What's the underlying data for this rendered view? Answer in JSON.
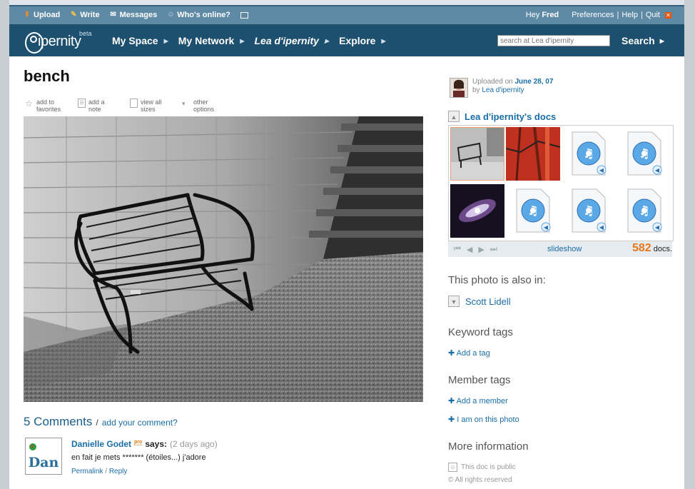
{
  "util": {
    "upload": "Upload",
    "write": "Write",
    "messages": "Messages",
    "whos_online": "Who's online?",
    "hey": "Hey",
    "user": "Fred",
    "preferences": "Preferences",
    "help": "Help",
    "quit": "Quit"
  },
  "nav": {
    "beta": "beta",
    "logo": "ipernity",
    "items": [
      "My Space",
      "My Network",
      "Lea d'ipernity",
      "Explore"
    ],
    "search_placeholder": "search at Lea d'ipernity",
    "search_button": "Search"
  },
  "photo": {
    "title": "bench",
    "actions": [
      {
        "label": "add to favorites",
        "icon": "star-icon"
      },
      {
        "label": "add a note",
        "icon": "note-icon"
      },
      {
        "label": "view all sizes",
        "icon": "pages-icon"
      },
      {
        "label": "other options",
        "icon": "chevron-down-icon"
      }
    ]
  },
  "comments": {
    "count_label": "5 Comments",
    "sep": "/",
    "add_label": "add your comment?",
    "items": [
      {
        "avatar_text": "Dan",
        "name": "Danielle Godet",
        "badge": "pro",
        "says": "says:",
        "ago": "(2 days ago)",
        "text": "en fait je mets ******* (étoiles...) j'adore",
        "permalink": "Permalink",
        "reply": "Reply"
      }
    ]
  },
  "sidebar": {
    "uploaded_on": "Uploaded on",
    "upload_date": "June 28, 07",
    "by": "by",
    "uploader": "Lea d'ipernity",
    "docs_title": "Lea d'ipernity's docs",
    "slideshow": "slideshow",
    "doc_count": "582",
    "doc_unit": "docs.",
    "also_in": "This photo is also in:",
    "also_in_link": "Scott Lidell",
    "keyword_tags": "Keyword tags",
    "add_tag": "Add a tag",
    "member_tags": "Member tags",
    "add_member": "Add a member",
    "i_am_on": "I am on this photo",
    "more_info": "More information",
    "public": "This doc is public",
    "rights": "© All rights reserved"
  }
}
